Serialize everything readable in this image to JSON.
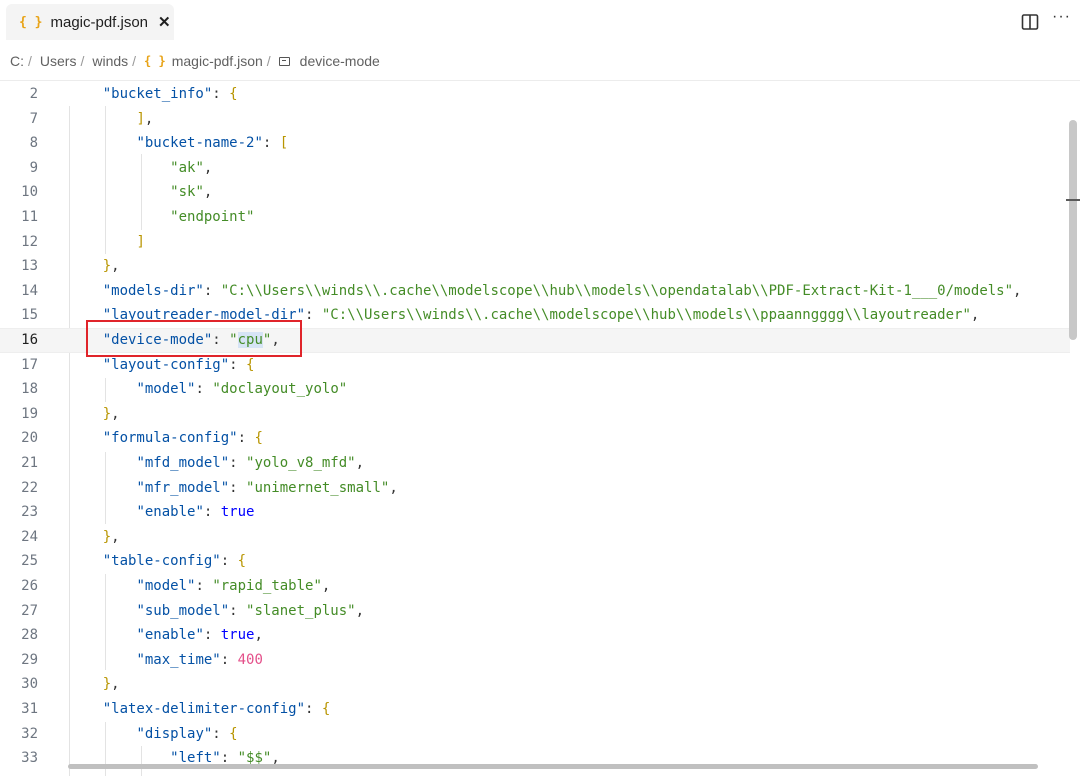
{
  "tab": {
    "icon_name": "json-braces-icon",
    "icon_text": "{ }",
    "label": "magic-pdf.json",
    "close": "✕"
  },
  "toolbar": {
    "split_icon": "split-editor-icon",
    "more_icon": "more-actions-icon",
    "more_text": "···"
  },
  "breadcrumb": {
    "items": [
      "C:",
      "Users",
      "winds",
      "magic-pdf.json",
      "device-mode"
    ],
    "separator": "/",
    "json_icon_text": "{ }"
  },
  "editor": {
    "current_line": "16",
    "lines": [
      {
        "n": "2"
      },
      {
        "n": "7"
      },
      {
        "n": "8"
      },
      {
        "n": "9"
      },
      {
        "n": "10"
      },
      {
        "n": "11"
      },
      {
        "n": "12"
      },
      {
        "n": "13"
      },
      {
        "n": "14"
      },
      {
        "n": "15"
      },
      {
        "n": "16"
      },
      {
        "n": "17"
      },
      {
        "n": "18"
      },
      {
        "n": "19"
      },
      {
        "n": "20"
      },
      {
        "n": "21"
      },
      {
        "n": "22"
      },
      {
        "n": "23"
      },
      {
        "n": "24"
      },
      {
        "n": "25"
      },
      {
        "n": "26"
      },
      {
        "n": "27"
      },
      {
        "n": "28"
      },
      {
        "n": "29"
      },
      {
        "n": "30"
      },
      {
        "n": "31"
      },
      {
        "n": "32"
      },
      {
        "n": "33"
      }
    ],
    "t": {
      "bucket_info": "\"bucket_info\"",
      "bucket_name_2": "\"bucket-name-2\"",
      "ak": "\"ak\"",
      "sk": "\"sk\"",
      "endpoint": "\"endpoint\"",
      "models_dir": "\"models-dir\"",
      "models_dir_val": "\"C:\\\\Users\\\\winds\\\\.cache\\\\modelscope\\\\hub\\\\models\\\\opendatalab\\\\PDF-Extract-Kit-1___0/models\"",
      "layoutreader_dir": "\"layoutreader-model-dir\"",
      "layoutreader_val": "\"C:\\\\Users\\\\winds\\\\.cache\\\\modelscope\\\\hub\\\\models\\\\ppaanngggg\\\\layoutreader\"",
      "device_mode": "\"device-mode\"",
      "cpu": "cpu",
      "layout_config": "\"layout-config\"",
      "model": "\"model\"",
      "doclayout_yolo": "\"doclayout_yolo\"",
      "formula_config": "\"formula-config\"",
      "mfd_model": "\"mfd_model\"",
      "yolo_v8_mfd": "\"yolo_v8_mfd\"",
      "mfr_model": "\"mfr_model\"",
      "unimernet_small": "\"unimernet_small\"",
      "enable": "\"enable\"",
      "true": "true",
      "table_config": "\"table-config\"",
      "rapid_table": "\"rapid_table\"",
      "sub_model": "\"sub_model\"",
      "slanet_plus": "\"slanet_plus\"",
      "max_time": "\"max_time\"",
      "max_time_val": "400",
      "latex_config": "\"latex-delimiter-config\"",
      "display": "\"display\"",
      "left": "\"left\"",
      "dollars": "\"$$\""
    }
  }
}
